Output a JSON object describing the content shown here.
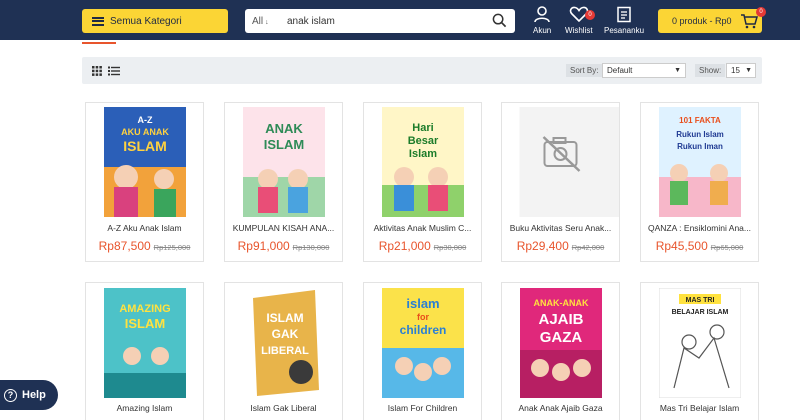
{
  "header": {
    "category_button": "Semua Kategori",
    "search": {
      "scope": "All",
      "query": "anak islam"
    },
    "account_label": "Akun",
    "wishlist_label": "Wishlist",
    "wishlist_count": "0",
    "orders_label": "Pesananku",
    "cart_label": "0 produk - Rp0",
    "cart_count": "0",
    "colors": {
      "navbar": "#1f3154",
      "accent_yellow": "#fbd535",
      "price_orange": "#e8552d"
    }
  },
  "toolbar": {
    "sort_label": "Sort By:",
    "sort_value": "Default",
    "show_label": "Show:",
    "show_value": "15"
  },
  "products": [
    {
      "title": "A-Z Aku Anak Islam",
      "price": "Rp87,500",
      "old_price": "Rp125,000",
      "cover_text": [
        "A-Z",
        "AKU ANAK",
        "ISLAM"
      ]
    },
    {
      "title": "KUMPULAN KISAH ANA...",
      "price": "Rp91,000",
      "old_price": "Rp130,000",
      "cover_text": [
        "ANAK",
        "ISLAM"
      ]
    },
    {
      "title": "Aktivitas Anak Muslim C...",
      "price": "Rp21,000",
      "old_price": "Rp30,000",
      "cover_text": [
        "Hari",
        "Besar",
        "Islam"
      ]
    },
    {
      "title": "Buku Aktivitas Seru Anak...",
      "price": "Rp29,400",
      "old_price": "Rp42,000",
      "cover_text": []
    },
    {
      "title": "QANZA : Ensiklomini Ana...",
      "price": "Rp45,500",
      "old_price": "Rp65,000",
      "cover_text": [
        "101 FAKTA",
        "Rukun Islam",
        "Rukun Iman"
      ]
    },
    {
      "title": "Amazing Islam",
      "price": "",
      "old_price": "",
      "cover_text": [
        "AMAZING",
        "ISLAM"
      ]
    },
    {
      "title": "Islam Gak Liberal",
      "price": "",
      "old_price": "",
      "cover_text": [
        "ISLAM",
        "GAK",
        "LIBERAL"
      ]
    },
    {
      "title": "Islam For Children",
      "price": "",
      "old_price": "",
      "cover_text": [
        "islam",
        "for",
        "children"
      ]
    },
    {
      "title": "Anak Anak Ajaib Gaza",
      "price": "",
      "old_price": "",
      "cover_text": [
        "ANAK-ANAK",
        "AJAIB",
        "GAZA"
      ]
    },
    {
      "title": "Mas Tri Belajar Islam",
      "price": "",
      "old_price": "",
      "cover_text": [
        "MAS TRI",
        "BELAJAR ISLAM"
      ]
    }
  ],
  "help_label": "Help"
}
